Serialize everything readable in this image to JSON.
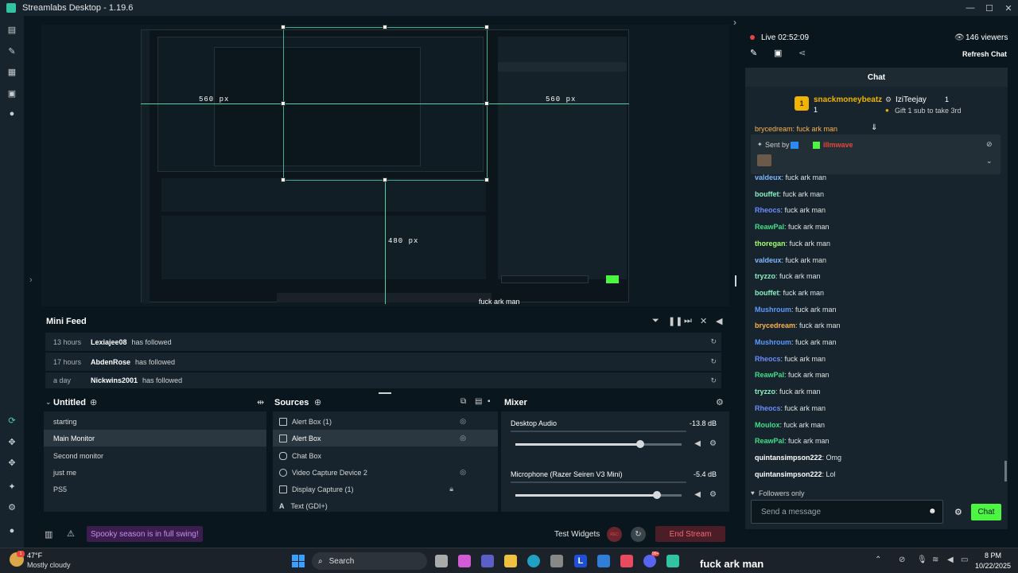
{
  "window": {
    "title": "Streamlabs Desktop - 1.19.6",
    "minimize": "—",
    "maximize": "☐",
    "close": "✕"
  },
  "preview": {
    "measure_top": "560 px",
    "measure_right": "560 px",
    "measure_mid": "480 px",
    "overlay_text": "fuck ark man"
  },
  "mini_feed": {
    "title": "Mini Feed",
    "rows": [
      {
        "time": "13 hours",
        "user": "Lexiajee08",
        "action": "has followed"
      },
      {
        "time": "17 hours",
        "user": "AbdenRose",
        "action": "has followed"
      },
      {
        "time": "a day",
        "user": "Nickwins2001",
        "action": "has followed"
      }
    ]
  },
  "scenes": {
    "title": "Untitled",
    "items": [
      "starting",
      "Main Monitor",
      "Second monitor",
      "just me",
      "PS5"
    ],
    "selected_index": 1
  },
  "sources": {
    "title": "Sources",
    "items": [
      "Alert Box (1)",
      "Alert Box",
      "Chat Box",
      "Video Capture Device 2",
      "Display Capture (1)",
      "Text (GDI+)"
    ],
    "selected_index": 1
  },
  "mixer": {
    "title": "Mixer",
    "channels": [
      {
        "name": "Desktop Audio",
        "db": "-13.8 dB",
        "level": 0.75
      },
      {
        "name": "Microphone (Razer Seiren V3 Mini)",
        "db": "-5.4 dB",
        "level": 0.85
      }
    ]
  },
  "footer": {
    "notice": "Spooky season is in full swing!",
    "test_widgets": "Test Widgets",
    "rec": "REC",
    "end_stream": "End Stream"
  },
  "live": {
    "status": "Live 02:52:09",
    "viewers": "146 viewers",
    "refresh_chat": "Refresh Chat"
  },
  "chat": {
    "title": "Chat",
    "leader_user": "snackmoneybeatz",
    "leader_rank": "1",
    "leader_count": "1",
    "gift_user": "IziTeejay",
    "gift_count": "1",
    "gift_text": "Gift 1 sub to take 3rd",
    "pinned_sent_by": "Sent by",
    "pinned_name": "illmwave",
    "partial_top": "brycedream: fuck ark man",
    "messages": [
      {
        "user": "valdeux",
        "text": "fuck ark man",
        "color": "#7fb7ff"
      },
      {
        "user": "bouffet",
        "text": "fuck ark man",
        "color": "#8af0c0"
      },
      {
        "user": "Rheocs",
        "text": "fuck ark man",
        "color": "#6c8dff"
      },
      {
        "user": "ReawPal",
        "text": "fuck ark man",
        "color": "#3ee08a"
      },
      {
        "user": "thoregan",
        "text": "fuck ark man",
        "color": "#a4ff6a"
      },
      {
        "user": "valdeux",
        "text": "fuck ark man",
        "color": "#7fb7ff"
      },
      {
        "user": "tryzzo",
        "text": "fuck ark man",
        "color": "#8af0c0"
      },
      {
        "user": "bouffet",
        "text": "fuck ark man",
        "color": "#8af0c0"
      },
      {
        "user": "Mushroum",
        "text": "fuck ark man",
        "color": "#5a9bff"
      },
      {
        "user": "brycedream",
        "text": "fuck ark man",
        "color": "#ffb44a"
      },
      {
        "user": "Mushroum",
        "text": "fuck ark man",
        "color": "#5a9bff"
      },
      {
        "user": "Rheocs",
        "text": "fuck ark man",
        "color": "#6c8dff"
      },
      {
        "user": "ReawPal",
        "text": "fuck ark man",
        "color": "#3ee08a"
      },
      {
        "user": "tryzzo",
        "text": "fuck ark man",
        "color": "#8af0c0"
      },
      {
        "user": "Rheocs",
        "text": "fuck ark man",
        "color": "#6c8dff"
      },
      {
        "user": "Moulox",
        "text": "fuck ark man",
        "color": "#3ee08a"
      },
      {
        "user": "ReawPal",
        "text": "fuck ark man",
        "color": "#3ee08a"
      },
      {
        "user": "quintansimpson222",
        "text": "Omg",
        "color": "#ffffff"
      },
      {
        "user": "quintansimpson222",
        "text": "Lol",
        "color": "#ffffff"
      }
    ],
    "followers_only": "Followers only",
    "input_placeholder": "Send a message",
    "send_button": "Chat"
  },
  "taskbar": {
    "weather_temp": "47°F",
    "weather_desc": "Mostly cloudy",
    "search": "Search",
    "time": "8 PM",
    "date": "10/22/2025",
    "badge": "99+"
  },
  "colors": {
    "accent": "#31c3a2",
    "chat_btn": "#4cf542",
    "live_dot": "#e8453c",
    "end_stream_bg": "#4b1d26",
    "notice_bg": "#3b1e4d"
  }
}
